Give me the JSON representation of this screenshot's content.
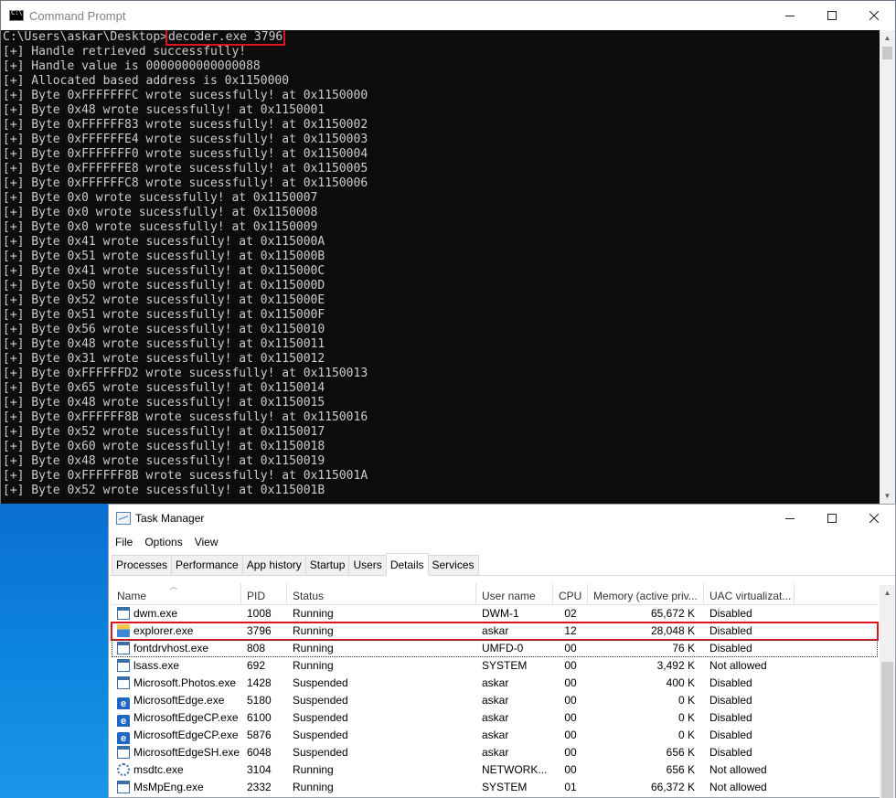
{
  "cmd": {
    "title": "Command Prompt",
    "prompt": "C:\\Users\\askar\\Desktop>",
    "command": "decoder.exe 3796",
    "output": [
      "[+] Handle retrieved successfully!",
      "[+] Handle value is 0000000000000088",
      "[+] Allocated based address is 0x1150000",
      "[+] Byte 0xFFFFFFFC wrote sucessfully! at 0x1150000",
      "[+] Byte 0x48 wrote sucessfully! at 0x1150001",
      "[+] Byte 0xFFFFFF83 wrote sucessfully! at 0x1150002",
      "[+] Byte 0xFFFFFFE4 wrote sucessfully! at 0x1150003",
      "[+] Byte 0xFFFFFFF0 wrote sucessfully! at 0x1150004",
      "[+] Byte 0xFFFFFFE8 wrote sucessfully! at 0x1150005",
      "[+] Byte 0xFFFFFFC8 wrote sucessfully! at 0x1150006",
      "[+] Byte 0x0 wrote sucessfully! at 0x1150007",
      "[+] Byte 0x0 wrote sucessfully! at 0x1150008",
      "[+] Byte 0x0 wrote sucessfully! at 0x1150009",
      "[+] Byte 0x41 wrote sucessfully! at 0x115000A",
      "[+] Byte 0x51 wrote sucessfully! at 0x115000B",
      "[+] Byte 0x41 wrote sucessfully! at 0x115000C",
      "[+] Byte 0x50 wrote sucessfully! at 0x115000D",
      "[+] Byte 0x52 wrote sucessfully! at 0x115000E",
      "[+] Byte 0x51 wrote sucessfully! at 0x115000F",
      "[+] Byte 0x56 wrote sucessfully! at 0x1150010",
      "[+] Byte 0x48 wrote sucessfully! at 0x1150011",
      "[+] Byte 0x31 wrote sucessfully! at 0x1150012",
      "[+] Byte 0xFFFFFFD2 wrote sucessfully! at 0x1150013",
      "[+] Byte 0x65 wrote sucessfully! at 0x1150014",
      "[+] Byte 0x48 wrote sucessfully! at 0x1150015",
      "[+] Byte 0xFFFFFF8B wrote sucessfully! at 0x1150016",
      "[+] Byte 0x52 wrote sucessfully! at 0x1150017",
      "[+] Byte 0x60 wrote sucessfully! at 0x1150018",
      "[+] Byte 0x48 wrote sucessfully! at 0x1150019",
      "[+] Byte 0xFFFFFF8B wrote sucessfully! at 0x115001A",
      "[+] Byte 0x52 wrote sucessfully! at 0x115001B"
    ]
  },
  "tm": {
    "title": "Task Manager",
    "menu": [
      "File",
      "Options",
      "View"
    ],
    "tabs": [
      "Processes",
      "Performance",
      "App history",
      "Startup",
      "Users",
      "Details",
      "Services"
    ],
    "active_tab": "Details",
    "columns": [
      "Name",
      "PID",
      "Status",
      "User name",
      "CPU",
      "Memory (active priv...",
      "UAC virtualizat..."
    ],
    "rows": [
      {
        "icon": "window-icon",
        "name": "dwm.exe",
        "pid": "1008",
        "status": "Running",
        "user": "DWM-1",
        "cpu": "02",
        "mem": "65,672 K",
        "uac": "Disabled"
      },
      {
        "icon": "explorer-icon",
        "name": "explorer.exe",
        "pid": "3796",
        "status": "Running",
        "user": "askar",
        "cpu": "12",
        "mem": "28,048 K",
        "uac": "Disabled"
      },
      {
        "icon": "window-icon",
        "name": "fontdrvhost.exe",
        "pid": "808",
        "status": "Running",
        "user": "UMFD-0",
        "cpu": "00",
        "mem": "76 K",
        "uac": "Disabled"
      },
      {
        "icon": "window-icon",
        "name": "lsass.exe",
        "pid": "692",
        "status": "Running",
        "user": "SYSTEM",
        "cpu": "00",
        "mem": "3,492 K",
        "uac": "Not allowed"
      },
      {
        "icon": "window-icon",
        "name": "Microsoft.Photos.exe",
        "pid": "1428",
        "status": "Suspended",
        "user": "askar",
        "cpu": "00",
        "mem": "400 K",
        "uac": "Disabled"
      },
      {
        "icon": "edge-icon",
        "name": "MicrosoftEdge.exe",
        "pid": "5180",
        "status": "Suspended",
        "user": "askar",
        "cpu": "00",
        "mem": "0 K",
        "uac": "Disabled"
      },
      {
        "icon": "edge-icon",
        "name": "MicrosoftEdgeCP.exe",
        "pid": "6100",
        "status": "Suspended",
        "user": "askar",
        "cpu": "00",
        "mem": "0 K",
        "uac": "Disabled"
      },
      {
        "icon": "edge-icon",
        "name": "MicrosoftEdgeCP.exe",
        "pid": "5876",
        "status": "Suspended",
        "user": "askar",
        "cpu": "00",
        "mem": "0 K",
        "uac": "Disabled"
      },
      {
        "icon": "window-icon",
        "name": "MicrosoftEdgeSH.exe",
        "pid": "6048",
        "status": "Suspended",
        "user": "askar",
        "cpu": "00",
        "mem": "656 K",
        "uac": "Disabled"
      },
      {
        "icon": "service-icon",
        "name": "msdtc.exe",
        "pid": "3104",
        "status": "Running",
        "user": "NETWORK...",
        "cpu": "00",
        "mem": "656 K",
        "uac": "Not allowed"
      },
      {
        "icon": "window-icon",
        "name": "MsMpEng.exe",
        "pid": "2332",
        "status": "Running",
        "user": "SYSTEM",
        "cpu": "01",
        "mem": "66,372 K",
        "uac": "Not allowed"
      }
    ]
  }
}
